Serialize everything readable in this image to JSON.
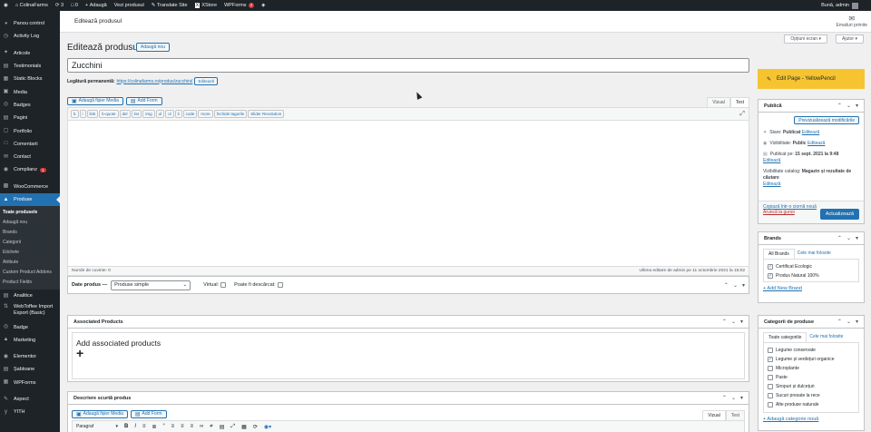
{
  "adminbar": {
    "site": "ColinaFarms",
    "updates": "3",
    "comments": "0",
    "new": "Adaugă",
    "view": "Vezi produsul",
    "translate": "Translate Site",
    "xstore": "XStore",
    "wpforms": "WPForms",
    "wpforms_count": "2",
    "greeting": "Bună, admin"
  },
  "sidebar": {
    "items": [
      {
        "label": "Panou control"
      },
      {
        "label": "Activity Log"
      },
      {
        "label": "Articole"
      },
      {
        "label": "Testimonials"
      },
      {
        "label": "Static Blocks"
      },
      {
        "label": "Media"
      },
      {
        "label": "Badges"
      },
      {
        "label": "Pagini"
      },
      {
        "label": "Portfolio"
      },
      {
        "label": "Comentarii"
      },
      {
        "label": "Contact"
      },
      {
        "label": "Complianz",
        "badge": "1"
      },
      {
        "label": "WooCommerce"
      },
      {
        "label": "Produse"
      }
    ],
    "submenu": [
      "Toate produsele",
      "Adaugă nou",
      "Brands",
      "Categorii",
      "Etichete",
      "Atribute",
      "Custom Product Addons",
      "Product Fields"
    ],
    "items2": [
      {
        "label": "Analitice"
      },
      {
        "label": "WebToffee Import Export (Basic)"
      },
      {
        "label": "Badge"
      },
      {
        "label": "Marketing"
      },
      {
        "label": "Elementor"
      },
      {
        "label": "Șabloane"
      },
      {
        "label": "WPForms"
      },
      {
        "label": "Aspect"
      },
      {
        "label": "YITH"
      }
    ]
  },
  "topbar": {
    "page_title": "Editează produsul",
    "notifications": "Emailuri primite"
  },
  "screen_options": "Opțiuni ecran",
  "help": "Ajutor",
  "heading": "Editează produsul",
  "add_new": "Adaugă nou",
  "title_value": "Zucchini",
  "permalink": {
    "label": "Legătură permanentă:",
    "url": "https://colinafarms.ro/produs/zucchini/",
    "edit": "Editează"
  },
  "editor": {
    "add_media": "Adaugă fișier Media",
    "add_form": "Add Form",
    "tab_visual": "Vizual",
    "tab_text": "Text",
    "quicktags": [
      "b",
      "i",
      "link",
      "b-quote",
      "del",
      "ins",
      "img",
      "ul",
      "ol",
      "li",
      "code",
      "more",
      "Închide tagurile",
      "Slider Revolution"
    ],
    "word_count": "Număr de cuvinte: 0",
    "last_edit": "Ultima editare de admin pe 11 octombrie 2021 la 15:02"
  },
  "product_data": {
    "label": "Date produs —",
    "type": "Produse simple",
    "virtual": "Virtual:",
    "downloadable": "Poate fi descărcat:"
  },
  "associated": {
    "title": "Associated Products",
    "add": "Add associated products"
  },
  "short_desc": {
    "title": "Descriere scurtă produs",
    "add_media": "Adaugă fișier Media",
    "add_form": "Add Form",
    "tab_visual": "Vizual",
    "tab_text": "Text",
    "paragraph": "Paragraf"
  },
  "yellowpencil": "Edit Page - YellowPencil",
  "publish": {
    "title": "Publică",
    "preview": "Previzualizează modificările",
    "status_label": "Stare:",
    "status": "Publicat",
    "visibility_label": "Vizibilitate:",
    "visibility": "Public",
    "published_label": "Publicat pe:",
    "published": "15 sept. 2021 la 9:48",
    "catalog_label": "Vizibilitate catalog:",
    "catalog": "Magazin și rezultate de căutare",
    "edit": "Editează",
    "copy": "Copiază într-o ciornă nouă",
    "trash": "Aruncă la gunoi",
    "update": "Actualizează"
  },
  "brands": {
    "title": "Brands",
    "tab_all": "All Brands",
    "tab_used": "Cele mai folosite",
    "items": [
      "Certificat Ecologic",
      "Produs Natural 100%"
    ],
    "add": "+ Add New Brand"
  },
  "categories": {
    "title": "Categorii de produse",
    "tab_all": "Toate categoriile",
    "tab_used": "Cele mai folosite",
    "items": [
      "Legume conservate",
      "Legume și verdețuri organice",
      "Microplante",
      "Paste",
      "Siropuri și dulcețuri",
      "Sucuri presate la rece",
      "Alte produse naturale"
    ],
    "checked": [
      false,
      true,
      false,
      false,
      false,
      false,
      false
    ],
    "add": "+ Adaugă categorie nouă"
  }
}
